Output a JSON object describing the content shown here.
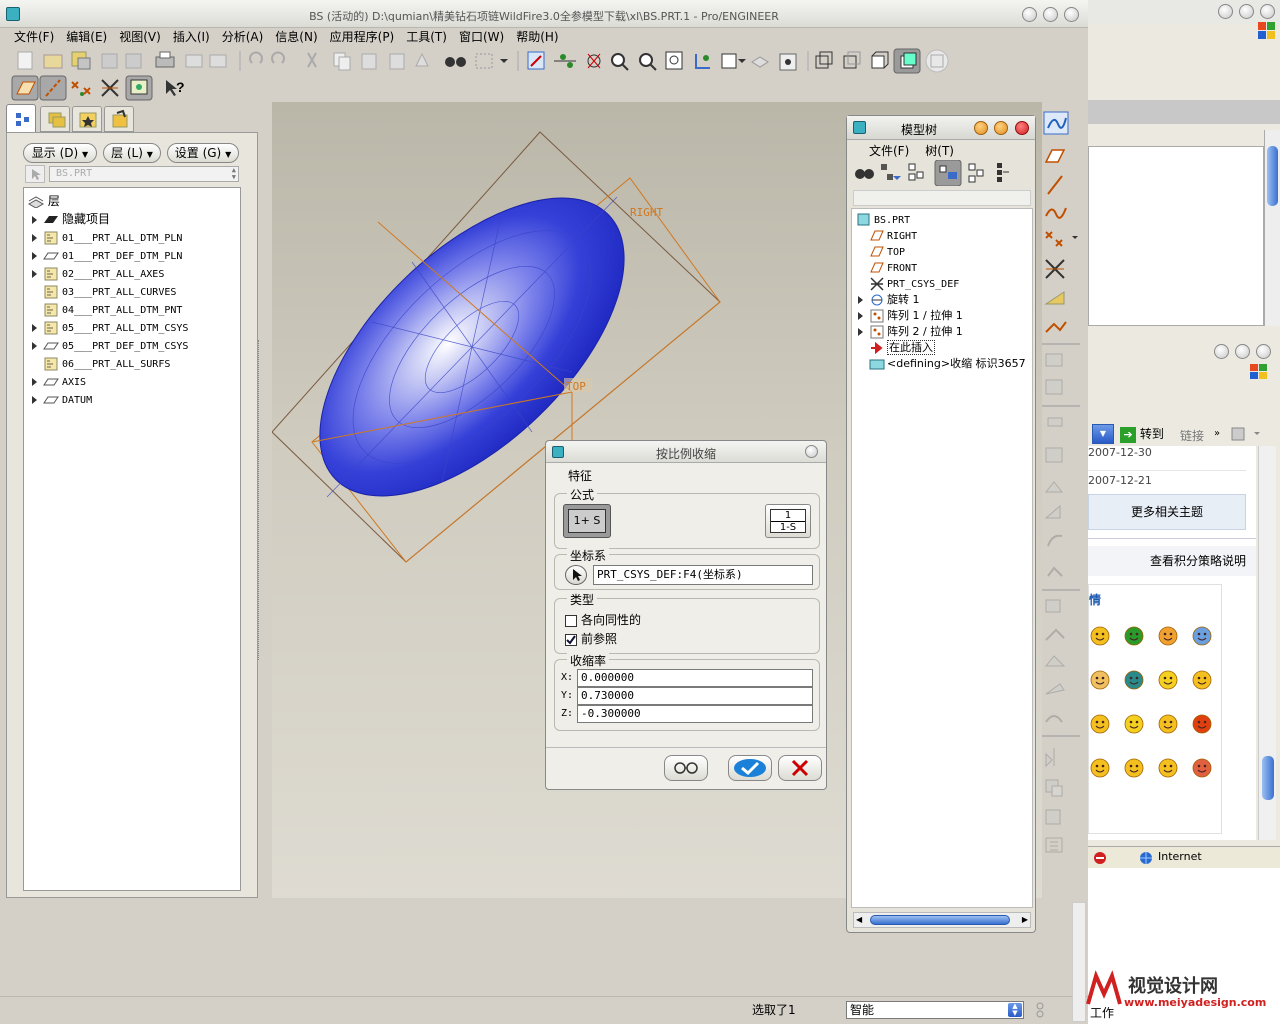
{
  "app": {
    "title": "BS (活动的) D:\\qumian\\精美钻石项链WildFire3.0全参模型下载\\xl\\BS.PRT.1 - Pro/ENGINEER",
    "menu": [
      "文件(F)",
      "编辑(E)",
      "视图(V)",
      "插入(I)",
      "分析(A)",
      "信息(N)",
      "应用程序(P)",
      "工具(T)",
      "窗口(W)",
      "帮助(H)"
    ]
  },
  "layer_panel": {
    "buttons": {
      "show": "显示 (D)",
      "layer": "层 (L)",
      "settings": "设置 (G)"
    },
    "selector_value": "BS.PRT",
    "root": "层",
    "items": [
      {
        "label": "隐藏项目",
        "expandable": true
      },
      {
        "label": "01___PRT_ALL_DTM_PLN",
        "expandable": true
      },
      {
        "label": "01___PRT_DEF_DTM_PLN",
        "expandable": true
      },
      {
        "label": "02___PRT_ALL_AXES",
        "expandable": true
      },
      {
        "label": "03___PRT_ALL_CURVES",
        "expandable": false
      },
      {
        "label": "04___PRT_ALL_DTM_PNT",
        "expandable": false
      },
      {
        "label": "05___PRT_ALL_DTM_CSYS",
        "expandable": true
      },
      {
        "label": "05___PRT_DEF_DTM_CSYS",
        "expandable": true
      },
      {
        "label": "06___PRT_ALL_SURFS",
        "expandable": false
      },
      {
        "label": "AXIS",
        "expandable": true
      },
      {
        "label": "DATUM",
        "expandable": true
      }
    ]
  },
  "viewport": {
    "label_right": "RIGHT",
    "label_top": "TOP"
  },
  "model_tree": {
    "title": "模型树",
    "menu": [
      "文件(F)",
      "树(T)"
    ],
    "items": [
      {
        "label": "BS.PRT",
        "level": 0,
        "expandable": false
      },
      {
        "label": "RIGHT",
        "level": 1,
        "expandable": false
      },
      {
        "label": "TOP",
        "level": 1,
        "expandable": false
      },
      {
        "label": "FRONT",
        "level": 1,
        "expandable": false
      },
      {
        "label": "PRT_CSYS_DEF",
        "level": 1,
        "expandable": false
      },
      {
        "label": "旋转 1",
        "level": 1,
        "expandable": true
      },
      {
        "label": "阵列 1 / 拉伸 1",
        "level": 1,
        "expandable": true
      },
      {
        "label": "阵列 2 / 拉伸 1",
        "level": 1,
        "expandable": true
      },
      {
        "label": "在此插入",
        "level": 1,
        "expandable": false
      },
      {
        "label": "<defining>收缩 标识3657",
        "level": 1,
        "expandable": false
      }
    ]
  },
  "shrink_dialog": {
    "title": "按比例收缩",
    "feature_label": "特征",
    "formula_label": "公式",
    "formula_a": "1+ S",
    "formula_b_num": "1",
    "formula_b_den": "1-S",
    "csys_label": "坐标系",
    "csys_value": "PRT_CSYS_DEF:F4(坐标系)",
    "type_label": "类型",
    "opt_isotropic": "各向同性的",
    "opt_isotropic_checked": false,
    "opt_forward": "前参照",
    "opt_forward_checked": true,
    "rate_label": "收缩率",
    "x_label": "X:",
    "x_value": "0.000000",
    "y_label": "Y:",
    "y_value": "0.730000",
    "z_label": "Z:",
    "z_value": "-0.300000"
  },
  "status": {
    "selected": "选取了1",
    "filter": "智能"
  },
  "browser": {
    "goto": "转到",
    "links": "链接",
    "date1": "2007-12-30",
    "date2": "2007-12-21",
    "more_topics": "更多相关主题",
    "points_link": "查看积分策略说明",
    "section_head": "情",
    "zone": "Internet",
    "bottom": "工作"
  },
  "watermark": {
    "site": "www.meiyadesign.com",
    "brand": "视觉设计网"
  },
  "colors": {
    "model": "#2d3bd6",
    "viewport_bg": "#cfcbbf",
    "accent": "#3a6bc8"
  }
}
